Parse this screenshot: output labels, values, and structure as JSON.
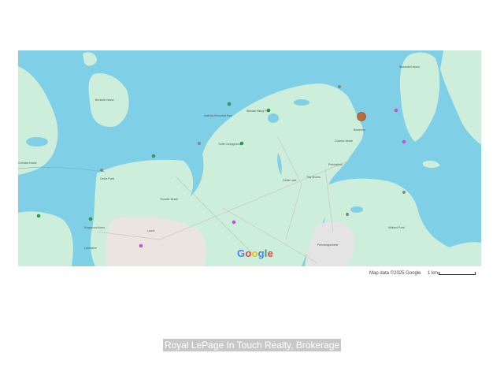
{
  "map": {
    "colors": {
      "water": "#7fd0e6",
      "land": "#cdeedb",
      "urban": "#eae6df",
      "road": "#c9c6b8",
      "park_pin": "#2e9a57",
      "marker": "#c0622a",
      "place_pin": "#c94fd6"
    },
    "logo_text": [
      "G",
      "o",
      "o",
      "g",
      "l",
      "e"
    ],
    "logo_colors": [
      "#4285F4",
      "#EA4335",
      "#FBBC05",
      "#4285F4",
      "#34A853",
      "#EA4335"
    ],
    "attribution": "Map data ©2025 Google",
    "scale_label": "1 km",
    "marker_icon": "location-dot-icon"
  },
  "labels": {
    "beckwith_island": "Beckwith Island",
    "christian_island": "Christian Island",
    "cedar_point": "Cedar Point",
    "kingswood_acres": "Kingswood Acres",
    "lafontaine": "Lafontaine",
    "laurin": "Laurin",
    "thunder_beach": "Thunder Beach",
    "awenda_park": "Awenda Provincial Park",
    "turtle_campground": "Turtle Campground",
    "wendat_hiking": "Wendat Hiking Trail",
    "bearberry": "Bearberry",
    "coutnac_beach": "Coutnac Beach",
    "cedar_lake": "Cedar Lake",
    "tiny_shores": "Tiny Shores",
    "penetanguishene": "Penetanguishene",
    "perkinsfield": "Perkinsfield",
    "midland_point": "Midland Point",
    "beausoleil_island": "Beausoleil Island"
  },
  "watermark": "Royal LePage In Touch Realty, Brokerage"
}
